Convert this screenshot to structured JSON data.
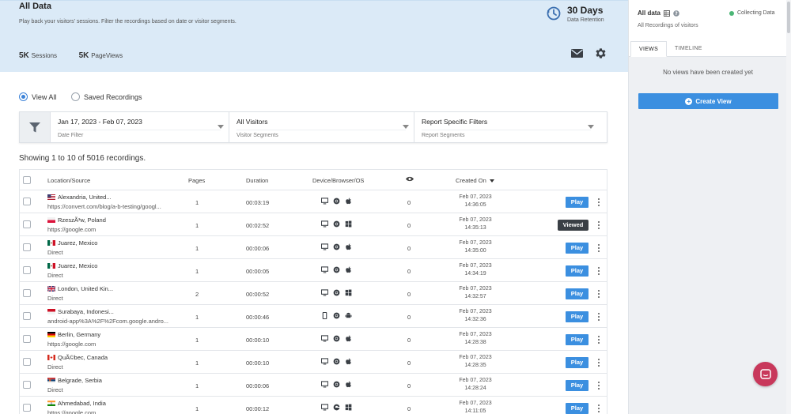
{
  "header": {
    "title": "All Data",
    "subtitle": "Play back your visitors' sessions. Filter the recordings based on date or visitor segments.",
    "sessions_value": "5K",
    "sessions_label": "Sessions",
    "pageviews_value": "5K",
    "pageviews_label": "PageViews",
    "retention_days": "30 Days",
    "retention_label": "Data Retention"
  },
  "view_options": {
    "view_all": "View All",
    "saved": "Saved Recordings",
    "selected": "view_all"
  },
  "filters": [
    {
      "main": "Jan 17, 2023 - Feb 07, 2023",
      "sub": "Date Filter"
    },
    {
      "main": "All Visitors",
      "sub": "Visitor Segments"
    },
    {
      "main": "Report Specific Filters",
      "sub": "Report Segments"
    }
  ],
  "showing_text": "Showing 1 to 10 of 5016 recordings.",
  "columns": {
    "location": "Location/Source",
    "pages": "Pages",
    "duration": "Duration",
    "device": "Device/Browser/OS",
    "created": "Created On"
  },
  "rows": [
    {
      "flag": "us",
      "location": "Alexandria, United...",
      "source": "https://convert.com/blog/a-b-testing/googl...",
      "pages": "1",
      "duration": "00:03:19",
      "device_icons": [
        "desktop-icon",
        "chrome-icon",
        "apple-icon"
      ],
      "views": "0",
      "date": "Feb 07, 2023",
      "time": "14:36:05",
      "action": "Play"
    },
    {
      "flag": "pl",
      "location": "RzeszÃ³w, Poland",
      "source": "https://google.com",
      "pages": "1",
      "duration": "00:02:52",
      "device_icons": [
        "desktop-icon",
        "chrome-icon",
        "windows-icon"
      ],
      "views": "0",
      "date": "Feb 07, 2023",
      "time": "14:35:13",
      "action": "Viewed"
    },
    {
      "flag": "mx",
      "location": "Juarez, Mexico",
      "source": "Direct",
      "pages": "1",
      "duration": "00:00:06",
      "device_icons": [
        "desktop-icon",
        "chrome-icon",
        "apple-icon"
      ],
      "views": "0",
      "date": "Feb 07, 2023",
      "time": "14:35:00",
      "action": "Play"
    },
    {
      "flag": "mx",
      "location": "Juarez, Mexico",
      "source": "Direct",
      "pages": "1",
      "duration": "00:00:05",
      "device_icons": [
        "desktop-icon",
        "chrome-icon",
        "apple-icon"
      ],
      "views": "0",
      "date": "Feb 07, 2023",
      "time": "14:34:19",
      "action": "Play"
    },
    {
      "flag": "gb",
      "location": "London, United Kin...",
      "source": "Direct",
      "pages": "2",
      "duration": "00:00:52",
      "device_icons": [
        "desktop-icon",
        "chrome-icon",
        "windows-icon"
      ],
      "views": "0",
      "date": "Feb 07, 2023",
      "time": "14:32:57",
      "action": "Play"
    },
    {
      "flag": "id",
      "location": "Surabaya, Indonesi...",
      "source": "android-app%3A%2F%2Fcom.google.andro...",
      "pages": "1",
      "duration": "00:00:46",
      "device_icons": [
        "mobile-icon",
        "chrome-icon",
        "android-icon"
      ],
      "views": "0",
      "date": "Feb 07, 2023",
      "time": "14:32:36",
      "action": "Play"
    },
    {
      "flag": "de",
      "location": "Berlin, Germany",
      "source": "https://google.com",
      "pages": "1",
      "duration": "00:00:10",
      "device_icons": [
        "desktop-icon",
        "chrome-icon",
        "apple-icon"
      ],
      "views": "0",
      "date": "Feb 07, 2023",
      "time": "14:28:38",
      "action": "Play"
    },
    {
      "flag": "ca",
      "location": "QuÃ©bec, Canada",
      "source": "Direct",
      "pages": "1",
      "duration": "00:00:10",
      "device_icons": [
        "desktop-icon",
        "chrome-icon",
        "apple-icon"
      ],
      "views": "0",
      "date": "Feb 07, 2023",
      "time": "14:28:35",
      "action": "Play"
    },
    {
      "flag": "rs",
      "location": "Belgrade, Serbia",
      "source": "Direct",
      "pages": "1",
      "duration": "00:00:06",
      "device_icons": [
        "desktop-icon",
        "chrome-icon",
        "apple-icon"
      ],
      "views": "0",
      "date": "Feb 07, 2023",
      "time": "14:28:24",
      "action": "Play"
    },
    {
      "flag": "in",
      "location": "Ahmedabad, India",
      "source": "https://google.com",
      "pages": "1",
      "duration": "00:00:12",
      "device_icons": [
        "desktop-icon",
        "edge-icon",
        "windows-icon"
      ],
      "views": "0",
      "date": "Feb 07, 2023",
      "time": "14:11:05",
      "action": "Play"
    }
  ],
  "right_panel": {
    "title": "All data",
    "subtitle": "All Recordings of visitors",
    "status": "Collecting Data",
    "tab_views": "VIEWS",
    "tab_timeline": "TIMELINE",
    "empty_text": "No views have been created yet",
    "create_label": "Create View"
  },
  "colors": {
    "accent": "#3b8fe0",
    "header_bg": "#dbeaf7",
    "viewed_bg": "#3a3f45",
    "status_green": "#4cb676",
    "chat_bg": "#c8385b"
  }
}
